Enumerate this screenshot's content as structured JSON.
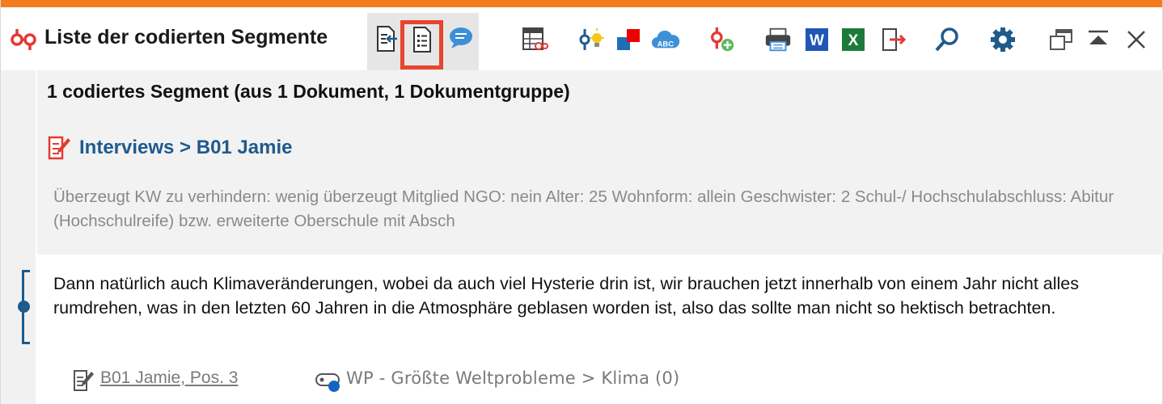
{
  "window": {
    "title": "Liste der codierten Segmente",
    "accent_color": "#f47b20"
  },
  "toolbar": {
    "buttons": [
      {
        "name": "export-to-document-icon"
      },
      {
        "name": "list-view-icon",
        "active": true
      },
      {
        "name": "comment-view-icon"
      },
      {
        "name": "table-filter-icon"
      },
      {
        "name": "code-lightbulb-icon"
      },
      {
        "name": "color-squares-icon"
      },
      {
        "name": "cloud-abc-icon"
      },
      {
        "name": "add-code-icon"
      },
      {
        "name": "print-icon"
      },
      {
        "name": "word-export-icon"
      },
      {
        "name": "excel-export-icon"
      },
      {
        "name": "export-arrow-icon"
      },
      {
        "name": "search-icon"
      },
      {
        "name": "settings-gear-icon"
      },
      {
        "name": "undock-window-icon"
      },
      {
        "name": "collapse-up-icon"
      },
      {
        "name": "close-icon"
      }
    ]
  },
  "summary": "1 codiertes Segment (aus 1 Dokument, 1 Dokumentgruppe)",
  "document": {
    "link": "Interviews > B01 Jamie",
    "variables": "Überzeugt KW zu verhindern: wenig überzeugt   Mitglied NGO: nein   Alter: 25   Wohnform: allein   Geschwister: 2   Schul-/ Hochschulabschluss: Abitur (Hochschulreife) bzw. erweiterte Oberschule mit Absch"
  },
  "segment": {
    "text": "Dann natürlich auch Klimaveränderungen, wobei da auch viel Hysterie drin ist, wir brauchen jetzt innerhalb von einem Jahr nicht alles rumdrehen, was in den letzten 60 Jahren in die Atmosphäre geblasen worden ist, also das sollte man nicht so hektisch betrachten.",
    "source": "B01 Jamie, Pos. 3",
    "code": "WP - Größte Weltprobleme > Klima (0)",
    "code_color": "#1565c0"
  }
}
